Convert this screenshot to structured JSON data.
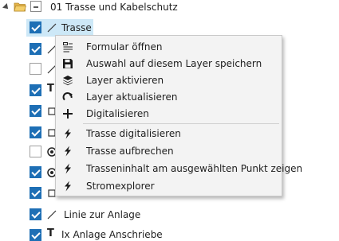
{
  "tree": {
    "root": {
      "label": "01 Trasse und Kabelschutz"
    },
    "items": [
      {
        "label": "Trasse",
        "checked": true,
        "icon": "line-icon",
        "selected": true
      },
      {
        "label": "",
        "checked": true,
        "icon": "line-icon"
      },
      {
        "label": "",
        "checked": false,
        "icon": "line-icon"
      },
      {
        "label": "",
        "checked": true,
        "icon": "text-icon"
      },
      {
        "label": "",
        "checked": true,
        "icon": "rect-icon"
      },
      {
        "label": "",
        "checked": true,
        "icon": "rect-icon"
      },
      {
        "label": "",
        "checked": false,
        "icon": "circle-point-icon"
      },
      {
        "label": "",
        "checked": true,
        "icon": "circle-point-icon"
      },
      {
        "label": "",
        "checked": true,
        "icon": "rect-icon"
      },
      {
        "label": "",
        "checked": true,
        "icon": "rect-icon"
      },
      {
        "label": "Linie zur Anlage",
        "checked": true,
        "icon": "line-icon"
      },
      {
        "label": "Ix Anlage Anschriebe",
        "checked": true,
        "icon": "text-icon"
      }
    ]
  },
  "context_menu": {
    "items": [
      {
        "label": "Formular öffnen",
        "icon": "form-icon"
      },
      {
        "label": "Auswahl auf diesem Layer speichern",
        "icon": "save-icon"
      },
      {
        "label": "Layer aktivieren",
        "icon": "layers-icon"
      },
      {
        "label": "Layer aktualisieren",
        "icon": "refresh-icon"
      },
      {
        "label": "Digitalisieren",
        "icon": "plus-icon"
      },
      {
        "label": "Trasse digitalisieren",
        "icon": "lightning-icon"
      },
      {
        "label": "Trasse aufbrechen",
        "icon": "lightning-icon"
      },
      {
        "label": "Trasseninhalt am ausgewählten Punkt zeigen",
        "icon": "lightning-icon"
      },
      {
        "label": "Stromexplorer",
        "icon": "lightning-icon"
      }
    ]
  },
  "colors": {
    "accent": "#1e6fb5",
    "selection": "#cde8f7",
    "menu_bg": "#f3f3f3",
    "folder": "#e8b84a"
  }
}
